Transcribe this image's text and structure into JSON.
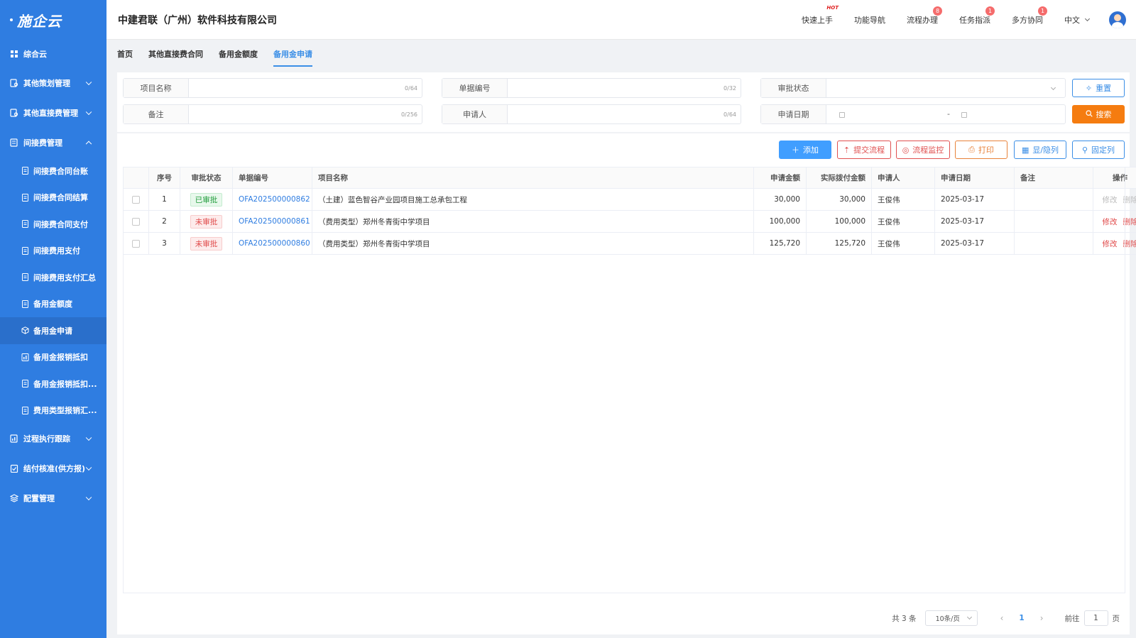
{
  "logo": "施企云",
  "sidebar": {
    "home": "综合云",
    "groups": [
      {
        "label": "其他策划管理",
        "icon": "doc-search-icon"
      },
      {
        "label": "其他直接费管理",
        "icon": "doc-search-icon"
      },
      {
        "label": "间接费管理",
        "icon": "doc-list-icon"
      }
    ],
    "sub_items": [
      "间接费合同台账",
      "间接费合同结算",
      "间接费合同支付",
      "间接费用支付",
      "间接费用支付汇总",
      "备用金额度",
      "备用金申请",
      "备用金报销抵扣",
      "备用金报销抵扣...",
      "费用类型报销汇..."
    ],
    "bottom_groups": [
      {
        "label": "过程执行跟踪"
      },
      {
        "label": "结付核准(供方报)"
      },
      {
        "label": "配置管理"
      }
    ]
  },
  "header": {
    "company": "中建君联（广州）软件科技有限公司",
    "nav": [
      {
        "label": "快速上手",
        "mark": "HOT"
      },
      {
        "label": "功能导航"
      },
      {
        "label": "流程办理",
        "badge": "8"
      },
      {
        "label": "任务指派",
        "badge": "1"
      },
      {
        "label": "多方协同",
        "badge": "1"
      }
    ],
    "lang": "中文"
  },
  "tabs": [
    "首页",
    "其他直接费合同",
    "备用金额度",
    "备用金申请"
  ],
  "search": {
    "project_name": {
      "label": "项目名称",
      "counter": "0/64"
    },
    "doc_no": {
      "label": "单据编号",
      "counter": "0/32"
    },
    "approval_status": {
      "label": "审批状态"
    },
    "remark": {
      "label": "备注",
      "counter": "0/256"
    },
    "applicant": {
      "label": "申请人",
      "counter": "0/64"
    },
    "apply_date": {
      "label": "申请日期",
      "separator": "-"
    },
    "reset": "重置",
    "search": "搜索"
  },
  "toolbar": {
    "add": "添加",
    "submit_flow": "提交流程",
    "flow_monitor": "流程监控",
    "print": "打印",
    "show_hide": "显/隐列",
    "fix_col": "固定列"
  },
  "table": {
    "headers": [
      "序号",
      "审批状态",
      "单据编号",
      "项目名称",
      "申请金额",
      "实际拨付金额",
      "申请人",
      "申请日期",
      "备注",
      "操作"
    ],
    "rows": [
      {
        "no": "1",
        "status": "已审批",
        "status_type": "ok",
        "doc": "OFA202500000862",
        "project": "（土建）蓝色智谷产业园项目施工总承包工程",
        "amount": "30,000",
        "paid": "30,000",
        "applicant": "王俊伟",
        "date": "2025-03-17",
        "remark": "",
        "edit": "修改",
        "del": "删除",
        "ops_enabled": false
      },
      {
        "no": "2",
        "status": "未审批",
        "status_type": "no",
        "doc": "OFA202500000861",
        "project": "（费用类型）郑州冬青街中学项目",
        "amount": "100,000",
        "paid": "100,000",
        "applicant": "王俊伟",
        "date": "2025-03-17",
        "remark": "",
        "edit": "修改",
        "del": "删除",
        "ops_enabled": true
      },
      {
        "no": "3",
        "status": "未审批",
        "status_type": "no",
        "doc": "OFA202500000860",
        "project": "（费用类型）郑州冬青街中学项目",
        "amount": "125,720",
        "paid": "125,720",
        "applicant": "王俊伟",
        "date": "2025-03-17",
        "remark": "",
        "edit": "修改",
        "del": "删除",
        "ops_enabled": true
      }
    ]
  },
  "pager": {
    "total": "共 3 条",
    "page_size": "10条/页",
    "current": "1",
    "goto_label": "前往",
    "goto_value": "1",
    "page_unit": "页"
  }
}
